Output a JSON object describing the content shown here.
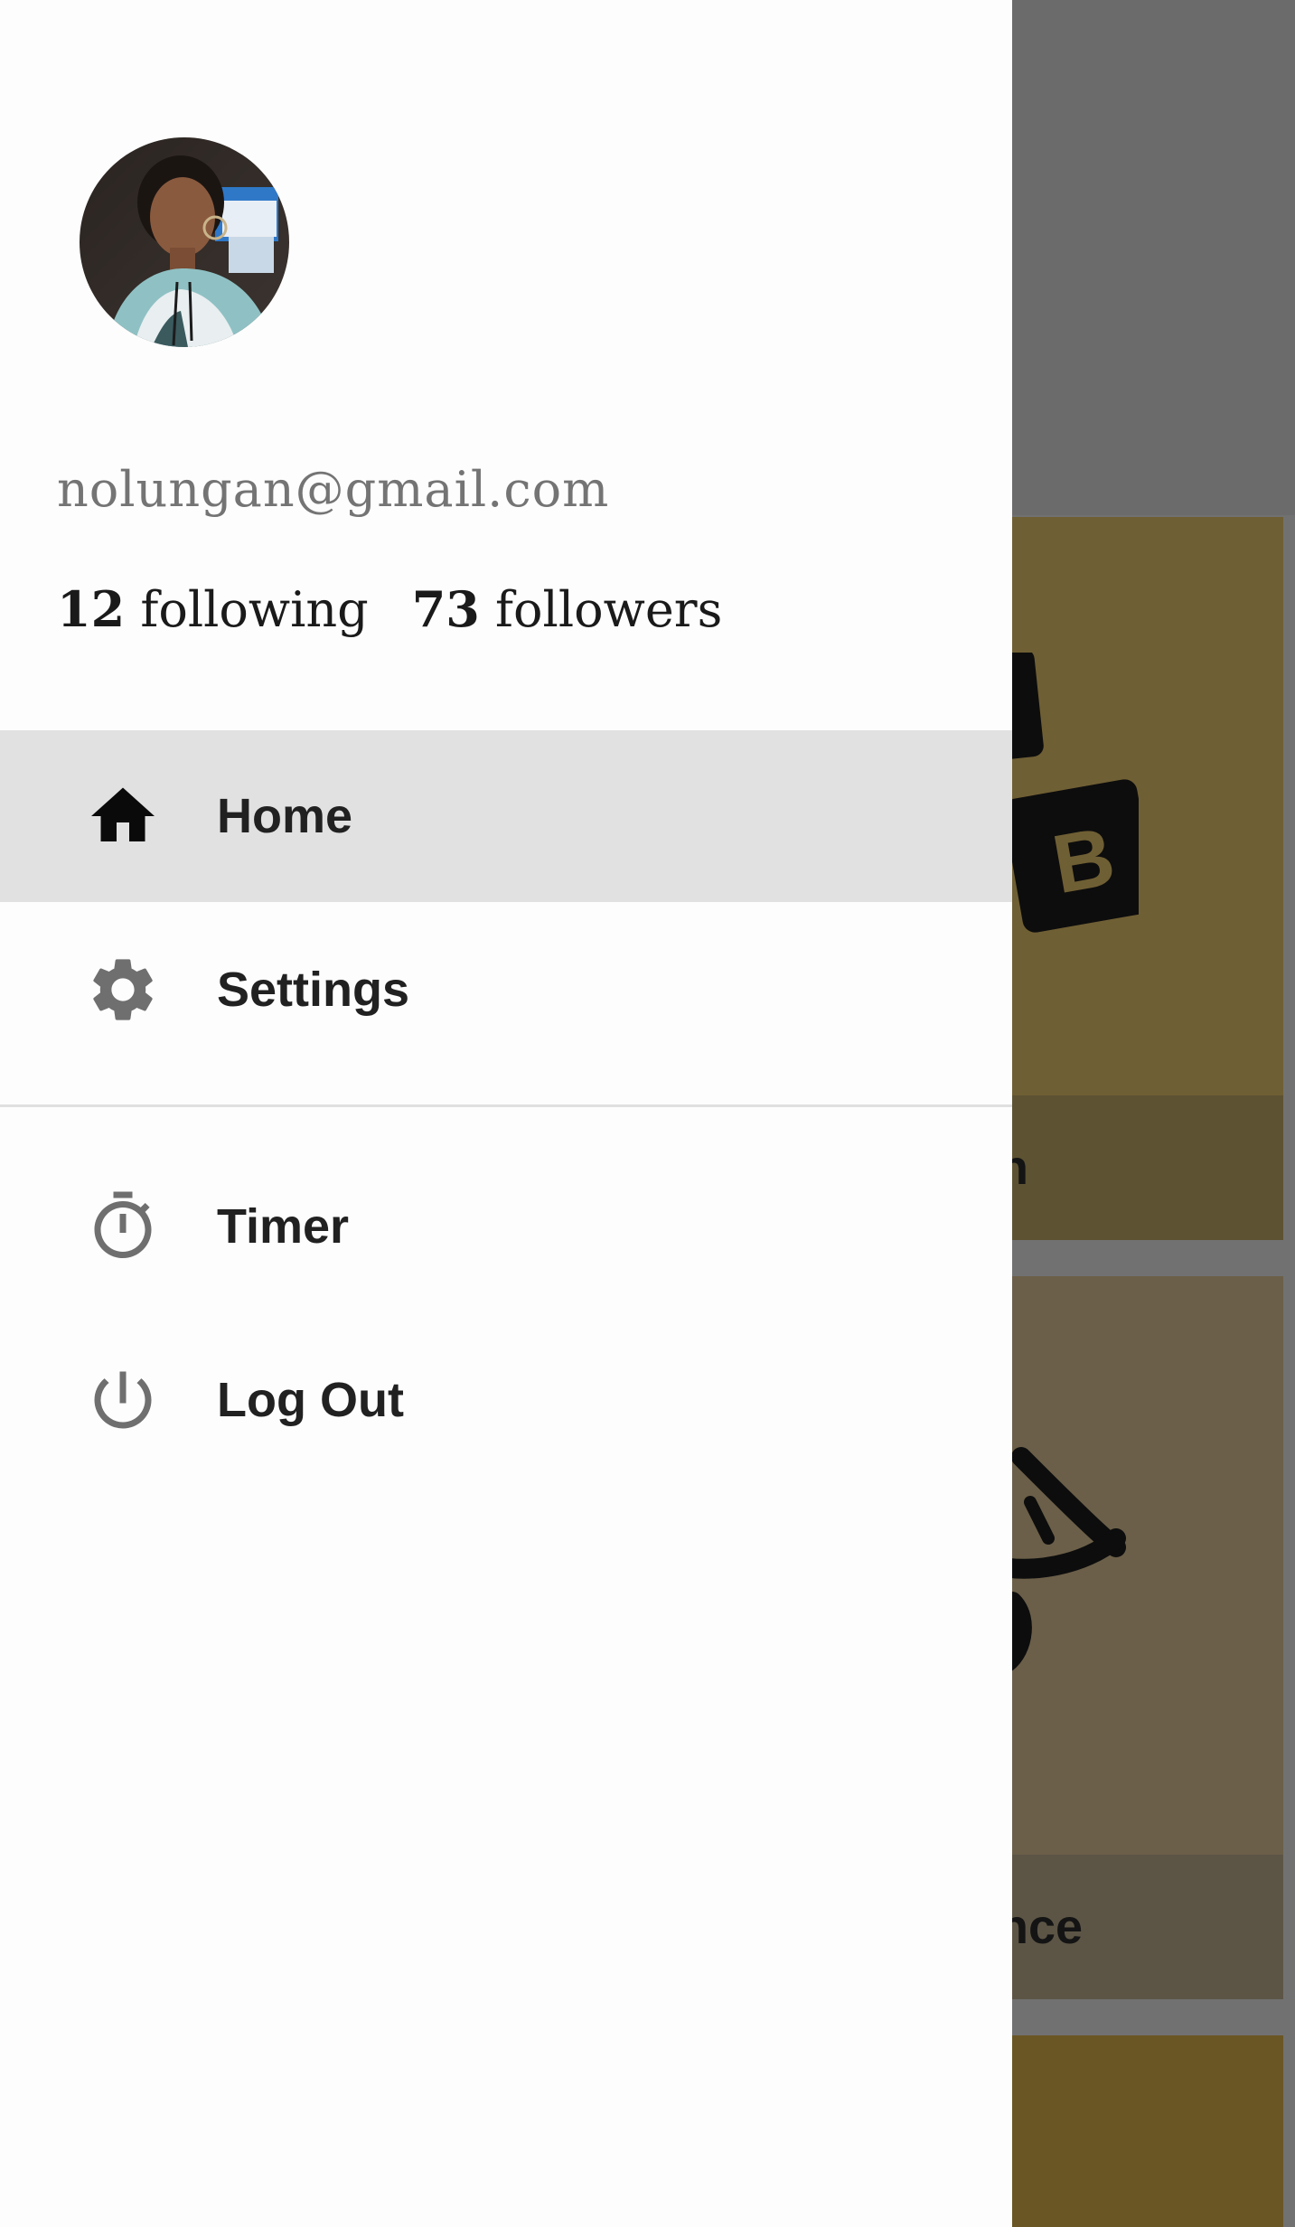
{
  "background": {
    "cards": [
      {
        "title": "English",
        "visible_text": "sh"
      },
      {
        "title": "Science",
        "visible_text": "ence"
      },
      {
        "title": ""
      }
    ]
  },
  "drawer": {
    "profile": {
      "avatar": "user-avatar-photo",
      "email": "nolungan@gmail.com",
      "following_count": "12",
      "following_label": "following",
      "followers_count": "73",
      "followers_label": "followers"
    },
    "menu": [
      {
        "label": "Home",
        "icon": "home-icon",
        "active": true
      },
      {
        "label": "Settings",
        "icon": "gear-icon",
        "active": false
      },
      {
        "label": "Timer",
        "icon": "stopwatch-icon",
        "active": false
      },
      {
        "label": "Log Out",
        "icon": "power-icon",
        "active": false
      }
    ]
  },
  "colors": {
    "drawer_bg": "#fdfdfd",
    "active_item_bg": "#e1e1e1",
    "scrim": "#6b6b6b",
    "card_accent": "#6f5f34"
  }
}
